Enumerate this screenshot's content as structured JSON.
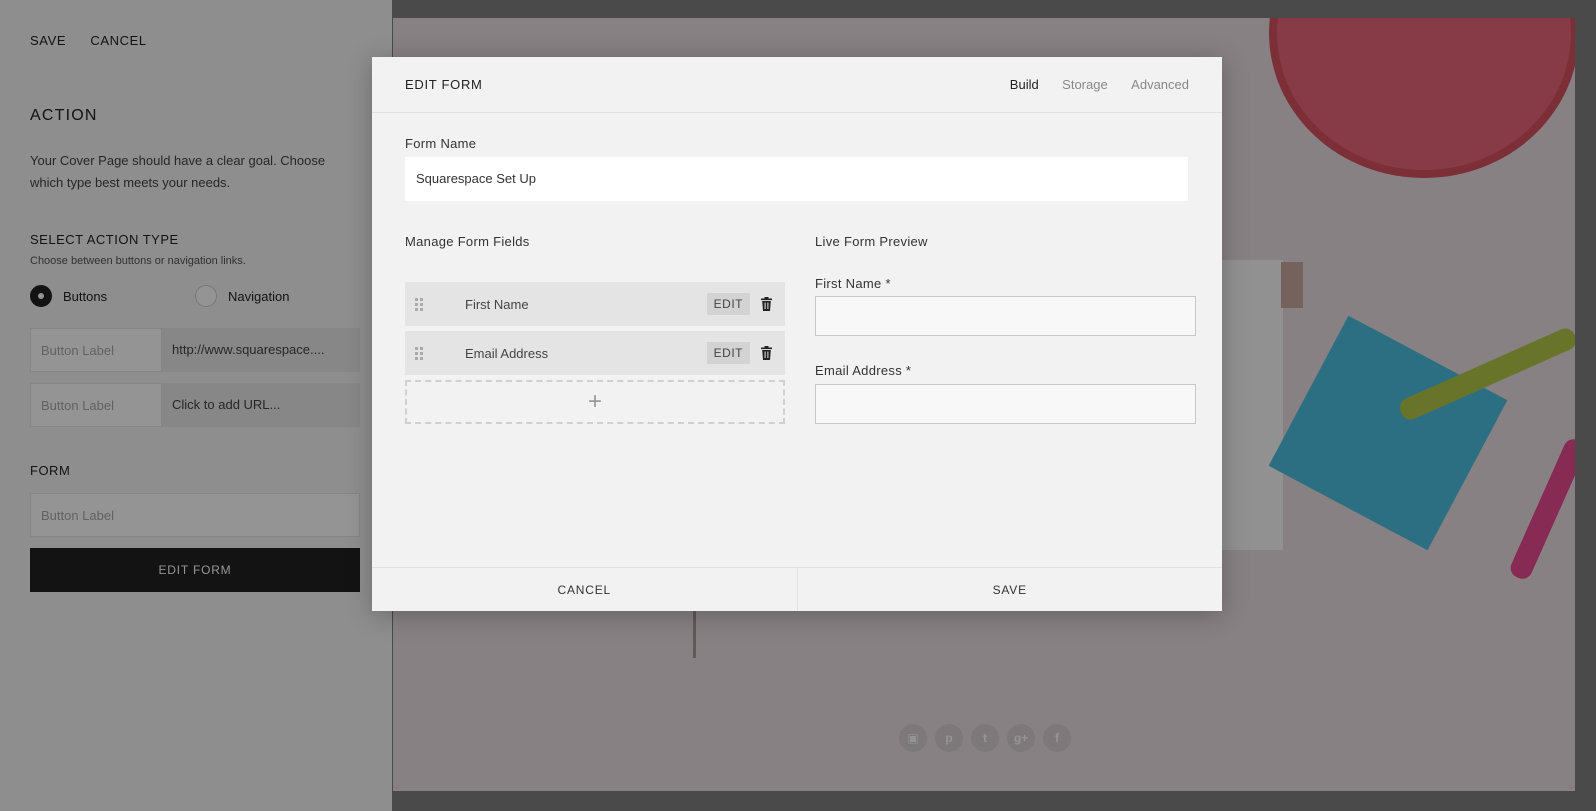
{
  "sidebar": {
    "save": "SAVE",
    "cancel": "CANCEL",
    "action_title": "ACTION",
    "action_desc": "Your Cover Page should have a clear goal. Choose which type best meets your needs.",
    "select_type_title": "SELECT ACTION TYPE",
    "select_type_hint": "Choose between buttons or navigation links.",
    "radio_buttons": "Buttons",
    "radio_navigation": "Navigation",
    "selected_type": "Buttons",
    "button_rows": [
      {
        "label_placeholder": "Button Label",
        "url": "http://www.squarespace...."
      },
      {
        "label_placeholder": "Button Label",
        "url": "Click to add URL..."
      }
    ],
    "form_title": "FORM",
    "form_label_placeholder": "Button Label",
    "edit_form_button": "EDIT FORM"
  },
  "preview": {
    "social_icons": [
      "instagram-icon",
      "pinterest-icon",
      "twitter-icon",
      "google-plus-icon",
      "facebook-icon"
    ]
  },
  "modal": {
    "title": "EDIT FORM",
    "tabs": [
      {
        "label": "Build",
        "active": true
      },
      {
        "label": "Storage",
        "active": false
      },
      {
        "label": "Advanced",
        "active": false
      }
    ],
    "form_name_label": "Form Name",
    "form_name_value": "Squarespace Set Up",
    "manage_fields_label": "Manage Form Fields",
    "fields": [
      {
        "name": "First Name",
        "edit": "EDIT"
      },
      {
        "name": "Email Address",
        "edit": "EDIT"
      }
    ],
    "add_field_symbol": "+",
    "live_preview_label": "Live Form Preview",
    "preview_fields": [
      {
        "label": "First Name *"
      },
      {
        "label": "Email Address *"
      }
    ],
    "footer_cancel": "CANCEL",
    "footer_save": "SAVE"
  }
}
